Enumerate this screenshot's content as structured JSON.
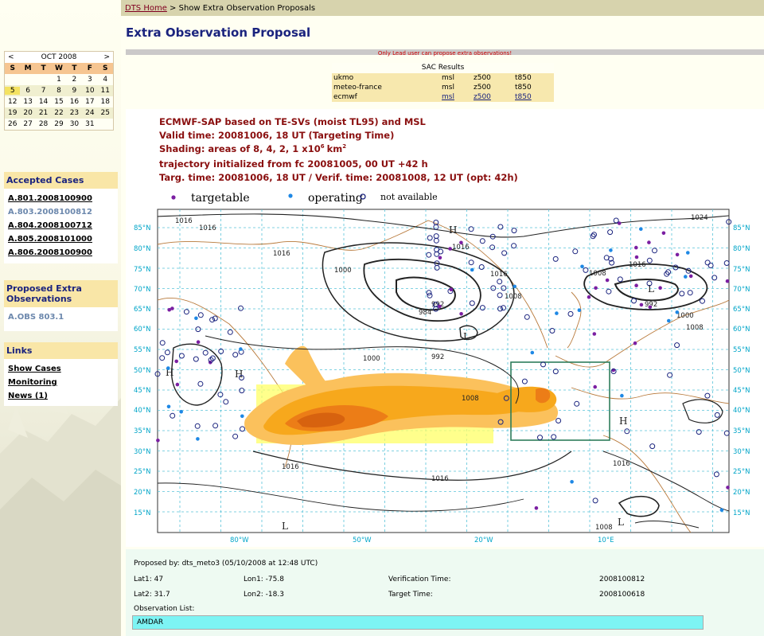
{
  "breadcrumb": {
    "home": "DTS Home",
    "separator": " > ",
    "current": "Show Extra Observation Proposals"
  },
  "page_title": "Extra Observation Proposal",
  "calendar": {
    "prev": "<",
    "next": ">",
    "month": "OCT 2008",
    "dow": [
      "S",
      "M",
      "T",
      "W",
      "T",
      "F",
      "S"
    ],
    "weeks": [
      [
        "",
        "",
        "",
        "1",
        "2",
        "3",
        "4"
      ],
      [
        "5",
        "6",
        "7",
        "8",
        "9",
        "10",
        "11"
      ],
      [
        "12",
        "13",
        "14",
        "15",
        "16",
        "17",
        "18"
      ],
      [
        "19",
        "20",
        "21",
        "22",
        "23",
        "24",
        "25"
      ],
      [
        "26",
        "27",
        "28",
        "29",
        "30",
        "31",
        ""
      ]
    ],
    "today": "5"
  },
  "accepted_cases": {
    "title": "Accepted Cases",
    "items": [
      "A.801.2008100900",
      "A.803.2008100812",
      "A.804.2008100712",
      "A.805.2008101000",
      "A.806.2008100900"
    ]
  },
  "proposed_extra": {
    "title": "Proposed Extra Observations",
    "items": [
      "A.OBS 803.1"
    ]
  },
  "links": {
    "title": "Links",
    "items": [
      "Show Cases",
      "Monitoring",
      "News (1)"
    ]
  },
  "lead_message": "Only Lead user can propose extra observations!",
  "sac": {
    "title": "SAC Results",
    "rows": [
      [
        "ukmo",
        "msl",
        "z500",
        "t850"
      ],
      [
        "meteo-france",
        "msl",
        "z500",
        "t850"
      ],
      [
        "ecmwf",
        "msl",
        "z500",
        "t850"
      ]
    ]
  },
  "chart": {
    "title_lines": [
      "ECMWF-SAP based on TE-SVs (moist TL95) and MSL",
      "Valid time: 20081006, 18 UT (Targeting Time)",
      "Shading: areas of 8, 4, 2, 1 x10",
      "trajectory initialized from fc 20081005, 00 UT +42 h",
      "Targ. time: 20081006, 18 UT / Verif. time: 20081008, 12 UT (opt: 42h)"
    ],
    "shading_exp": "6",
    "shading_unit": "km",
    "shading_unit_exp": "2",
    "legend": {
      "targetable": "targetable",
      "operating": "operating",
      "not_available": "not available"
    },
    "colors": {
      "targetable": "#7b1fa2",
      "operating": "#1e88e5",
      "shade": "#f7a81c",
      "box": "#ffff66",
      "target_box": "#2e7d5b"
    },
    "lat_labels": [
      "85°N",
      "80°N",
      "75°N",
      "70°N",
      "65°N",
      "60°N",
      "55°N",
      "50°N",
      "45°N",
      "40°N",
      "35°N",
      "30°N",
      "25°N",
      "20°N",
      "15°N"
    ],
    "lon_labels": [
      "80°W",
      "50°W",
      "20°W",
      "10°E"
    ],
    "isobars": [
      "1016",
      "1016",
      "1016",
      "1016",
      "1008",
      "1000",
      "992",
      "984",
      "992",
      "1000",
      "1008",
      "1016",
      "1024",
      "1008",
      "992",
      "1000",
      "1008",
      "1016",
      "1016",
      "1016",
      "1016",
      "1008"
    ],
    "highs_lows": [
      "H",
      "H",
      "L",
      "L",
      "H",
      "L",
      "L",
      "H"
    ]
  },
  "proposal": {
    "proposed_by": "Proposed by: dts_meto3 (05/10/2008 at 12:48 UTC)",
    "lat1": "Lat1: 47",
    "lon1": "Lon1: -75.8",
    "verification_label": "Verification Time:",
    "verification_value": "2008100812",
    "lat2": "Lat2: 31.7",
    "lon2": "Lon2: -18.3",
    "target_label": "Target Time:",
    "target_value": "2008100618",
    "obs_list_label": "Observation List:",
    "obs_item": "AMDAR"
  }
}
